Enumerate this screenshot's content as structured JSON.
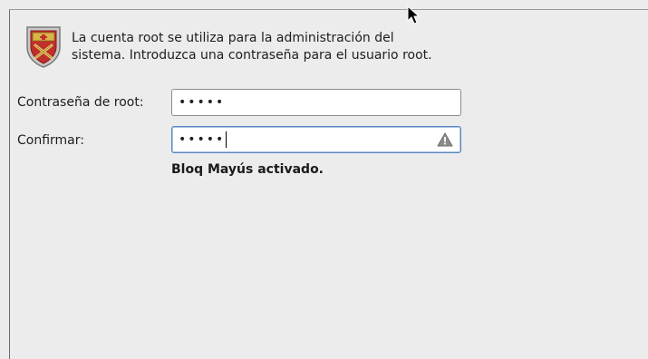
{
  "description": {
    "line1": "La cuenta root se utiliza para la administración del",
    "line2": "sistema. Introduzca una contraseña para el usuario root."
  },
  "form": {
    "password_label": "Contraseña de root:",
    "password_value": "•••••",
    "confirm_label": "Confirmar:",
    "confirm_value": "•••••",
    "capslock_warning": "Bloq Mayús activado."
  },
  "icons": {
    "header": "shield-icon",
    "warning": "warning-icon",
    "cursor": "mouse-pointer-icon"
  },
  "colors": {
    "background": "#ececec",
    "focus_border": "#5b86c0",
    "shield_red": "#c0302a",
    "shield_gold": "#d8b44a"
  }
}
